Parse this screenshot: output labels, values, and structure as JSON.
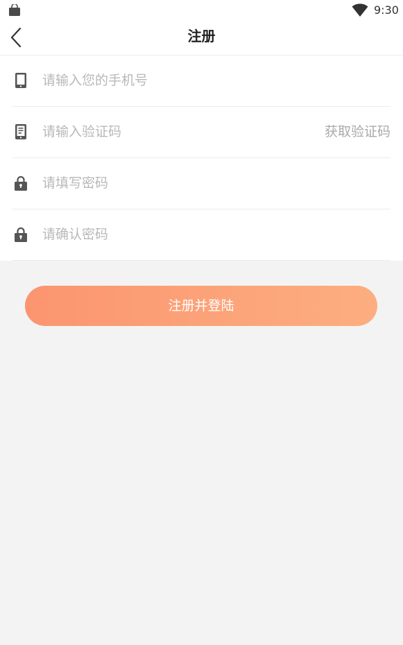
{
  "status_bar": {
    "time": "9:30",
    "left_icon": "shopping-bag-icon",
    "wifi_icon": "wifi-icon"
  },
  "nav": {
    "title": "注册",
    "back_icon": "chevron-left-icon"
  },
  "form": {
    "phone": {
      "icon": "phone-icon",
      "placeholder": "请输入您的手机号",
      "value": ""
    },
    "code": {
      "icon": "verification-code-icon",
      "placeholder": "请输入验证码",
      "value": "",
      "get_code_label": "获取验证码"
    },
    "password": {
      "icon": "lock-icon",
      "placeholder": "请填写密码",
      "value": ""
    },
    "confirm_password": {
      "icon": "lock-icon",
      "placeholder": "请确认密码",
      "value": ""
    }
  },
  "submit": {
    "label": "注册并登陆"
  },
  "colors": {
    "accent_start": "#fb9570",
    "accent_end": "#fcae80",
    "background": "#f3f3f3",
    "placeholder": "#b8b8b8"
  }
}
